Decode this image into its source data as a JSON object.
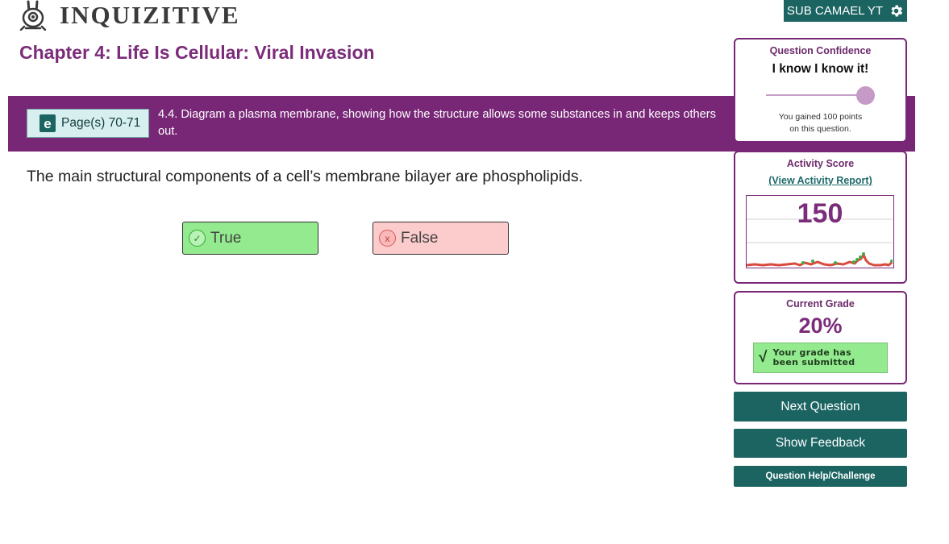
{
  "brand": {
    "logo_text": "INQUIZITIVE"
  },
  "user": {
    "name": "SUB CAMAEL YT",
    "settings_icon": "gear-icon"
  },
  "chapter": {
    "title": "Chapter 4: Life Is Cellular: Viral Invasion"
  },
  "objective": {
    "page_ref": "Page(s) 70-71",
    "ebook_icon_label": "e",
    "text": "4.4. Diagram a plasma membrane, showing how the structure allows some substances in and keeps others out."
  },
  "question": {
    "prompt": "The main structural components of a cell’s membrane bilayer are phospholipids.",
    "answers": [
      {
        "label": "True",
        "status": "correct",
        "icon": "check-circle-icon"
      },
      {
        "label": "False",
        "status": "incorrect",
        "icon": "x-circle-icon"
      }
    ]
  },
  "confidence": {
    "label": "Question Confidence",
    "value": "I know I know it!",
    "level": 1.0,
    "note_line1": "You gained 100 points",
    "note_line2": "on this question."
  },
  "activity": {
    "label": "Activity Score",
    "report_link": "(View Activity Report)",
    "score": "150"
  },
  "grade": {
    "label": "Current Grade",
    "value": "20%",
    "check_glyph": "√",
    "submitted_line1": "Your grade has",
    "submitted_line2": "been submitted"
  },
  "actions": {
    "next": "Next Question",
    "feedback": "Show Feedback",
    "help": "Question Help/Challenge"
  },
  "colors": {
    "brand_purple": "#782776",
    "teal": "#1b6462",
    "correct_green": "#93ea8f",
    "incorrect_pink": "#fccbcb"
  }
}
